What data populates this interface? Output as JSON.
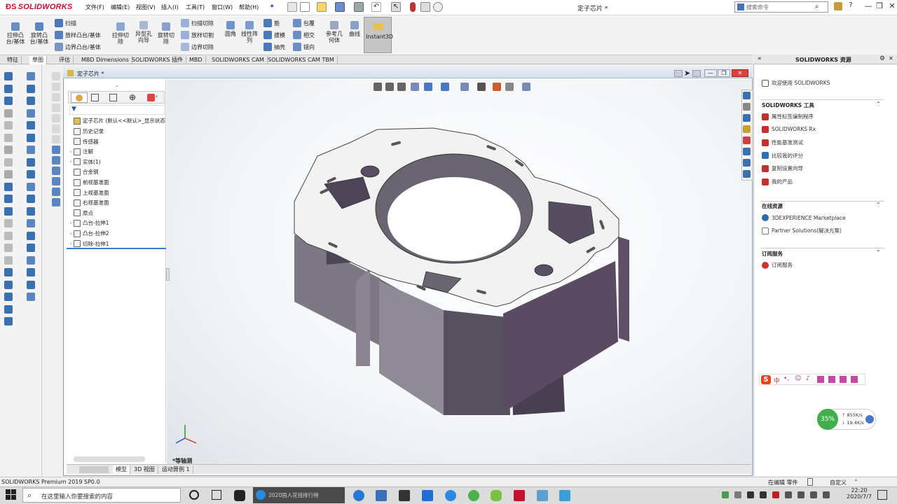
{
  "app": {
    "logo_text": "SOLIDWORKS",
    "document_title": "定子芯片 *",
    "search_placeholder": "搜索命令",
    "help_label": "?"
  },
  "menu": [
    "文件(F)",
    "编辑(E)",
    "视图(V)",
    "插入(I)",
    "工具(T)",
    "窗口(W)",
    "帮助(H)"
  ],
  "ribbon": {
    "extruded_boss": "拉伸凸台/基体",
    "revolved_boss": "旋转凸台/基体",
    "swept_boss": "扫描",
    "lofted_boss": "放样凸台/基体",
    "boundary_boss": "边界凸台/基体",
    "extruded_cut": "拉伸切除",
    "hole_wizard": "异型孔向导",
    "revolved_cut": "旋转切除",
    "swept_cut": "扫描切除",
    "lofted_cut": "放样切割",
    "boundary_cut": "边界切除",
    "fillet": "圆角",
    "linear_pattern": "线性阵列",
    "rib": "筋",
    "draft": "拔模",
    "shell": "抽壳",
    "wrap": "包覆",
    "intersect": "相交",
    "mirror": "镜向",
    "ref_geometry": "参考几何体",
    "curves": "曲线",
    "instant3d": "Instant3D"
  },
  "tabs": [
    "特征",
    "草图",
    "评估",
    "MBD Dimensions",
    "SOLIDWORKS 插件",
    "MBD",
    "SOLIDWORKS CAM",
    "SOLIDWORKS CAM TBM"
  ],
  "tree": {
    "root": "定子芯片 (默认<<默认>_显示状态",
    "nodes": [
      {
        "label": "历史记录",
        "expand": ""
      },
      {
        "label": "传感器",
        "expand": ""
      },
      {
        "label": "注解",
        "expand": "›"
      },
      {
        "label": "实体(1)",
        "expand": "›"
      },
      {
        "label": "合金钢",
        "expand": ""
      },
      {
        "label": "前视基准面",
        "expand": ""
      },
      {
        "label": "上视基准面",
        "expand": ""
      },
      {
        "label": "右视基准面",
        "expand": ""
      },
      {
        "label": "原点",
        "expand": ""
      },
      {
        "label": "凸台-拉伸1",
        "expand": "›"
      },
      {
        "label": "凸台-拉伸2",
        "expand": "›"
      },
      {
        "label": "切除-拉伸1",
        "expand": "›"
      }
    ]
  },
  "viewport": {
    "view_label": "*等轴测"
  },
  "bottom_tabs": [
    "模型",
    "3D 视图",
    "运动算例 1"
  ],
  "resources": {
    "header": "SOLIDWORKS 资源",
    "welcome": "欢迎使用 SOLIDWORKS",
    "tools_title": "SOLIDWORKS 工具",
    "tools": [
      "属性标签编制程序",
      "SOLIDWORKS Rx",
      "性能基准测试",
      "比较我的评分",
      "复制设置向导",
      "我的产品"
    ],
    "online_title": "在线资源",
    "online": [
      "3DEXPERIENCE Marketplace",
      "Partner Solutions(解决方案)"
    ],
    "sub_title": "订阅服务",
    "sub": [
      "订阅服务"
    ]
  },
  "widget": {
    "percent": "35%",
    "up": "855K/s",
    "down": "19.4K/s"
  },
  "status": {
    "left": "SOLIDWORKS Premium 2019 SP0.0",
    "editing": "在编辑 零件",
    "custom": "自定义"
  },
  "taskbar": {
    "search_placeholder": "在这里输入你要搜索的内容",
    "ie_tab": "2020国人花钱排行榜",
    "time": "22:20",
    "date": "2020/7/7"
  }
}
